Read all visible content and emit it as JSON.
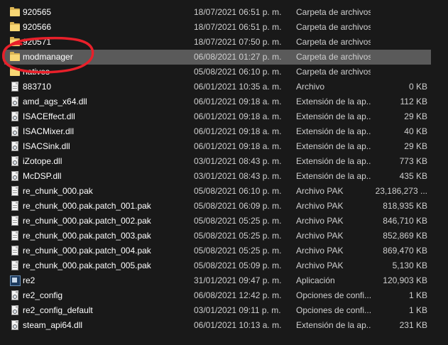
{
  "rows": [
    {
      "name": "920565",
      "date": "18/07/2021 06:51 p. m.",
      "type": "Carpeta de archivos",
      "size": "",
      "icon": "folder-icon"
    },
    {
      "name": "920566",
      "date": "18/07/2021 06:51 p. m.",
      "type": "Carpeta de archivos",
      "size": "",
      "icon": "folder-icon"
    },
    {
      "name": "920571",
      "date": "18/07/2021 07:50 p. m.",
      "type": "Carpeta de archivos",
      "size": "",
      "icon": "folder-icon"
    },
    {
      "name": "modmanager",
      "date": "06/08/2021 01:27 p. m.",
      "type": "Carpeta de archivos",
      "size": "",
      "icon": "folder-icon",
      "selected": true
    },
    {
      "name": "natives",
      "date": "05/08/2021 06:10 p. m.",
      "type": "Carpeta de archivos",
      "size": "",
      "icon": "folder-icon"
    },
    {
      "name": "883710",
      "date": "06/01/2021 10:35 a. m.",
      "type": "Archivo",
      "size": "0 KB",
      "icon": "file-icon"
    },
    {
      "name": "amd_ags_x64.dll",
      "date": "06/01/2021 09:18 a. m.",
      "type": "Extensión de la ap...",
      "size": "112 KB",
      "icon": "dll-file-icon"
    },
    {
      "name": "ISACEffect.dll",
      "date": "06/01/2021 09:18 a. m.",
      "type": "Extensión de la ap...",
      "size": "29 KB",
      "icon": "dll-file-icon"
    },
    {
      "name": "ISACMixer.dll",
      "date": "06/01/2021 09:18 a. m.",
      "type": "Extensión de la ap...",
      "size": "40 KB",
      "icon": "dll-file-icon"
    },
    {
      "name": "ISACSink.dll",
      "date": "06/01/2021 09:18 a. m.",
      "type": "Extensión de la ap...",
      "size": "29 KB",
      "icon": "dll-file-icon"
    },
    {
      "name": "iZotope.dll",
      "date": "03/01/2021 08:43 p. m.",
      "type": "Extensión de la ap...",
      "size": "773 KB",
      "icon": "dll-file-icon"
    },
    {
      "name": "McDSP.dll",
      "date": "03/01/2021 08:43 p. m.",
      "type": "Extensión de la ap...",
      "size": "435 KB",
      "icon": "dll-file-icon"
    },
    {
      "name": "re_chunk_000.pak",
      "date": "05/08/2021 06:10 p. m.",
      "type": "Archivo PAK",
      "size": "23,186,273 ...",
      "icon": "file-icon"
    },
    {
      "name": "re_chunk_000.pak.patch_001.pak",
      "date": "05/08/2021 06:09 p. m.",
      "type": "Archivo PAK",
      "size": "818,935 KB",
      "icon": "file-icon"
    },
    {
      "name": "re_chunk_000.pak.patch_002.pak",
      "date": "05/08/2021 05:25 p. m.",
      "type": "Archivo PAK",
      "size": "846,710 KB",
      "icon": "file-icon"
    },
    {
      "name": "re_chunk_000.pak.patch_003.pak",
      "date": "05/08/2021 05:25 p. m.",
      "type": "Archivo PAK",
      "size": "852,869 KB",
      "icon": "file-icon"
    },
    {
      "name": "re_chunk_000.pak.patch_004.pak",
      "date": "05/08/2021 05:25 p. m.",
      "type": "Archivo PAK",
      "size": "869,470 KB",
      "icon": "file-icon"
    },
    {
      "name": "re_chunk_000.pak.patch_005.pak",
      "date": "05/08/2021 05:09 p. m.",
      "type": "Archivo PAK",
      "size": "5,130 KB",
      "icon": "file-icon"
    },
    {
      "name": "re2",
      "date": "31/01/2021 09:47 p. m.",
      "type": "Aplicación",
      "size": "120,903 KB",
      "icon": "application-icon"
    },
    {
      "name": "re2_config",
      "date": "06/08/2021 12:42 p. m.",
      "type": "Opciones de confi...",
      "size": "1 KB",
      "icon": "config-file-icon"
    },
    {
      "name": "re2_config_default",
      "date": "03/01/2021 09:11 p. m.",
      "type": "Opciones de confi...",
      "size": "1 KB",
      "icon": "config-file-icon"
    },
    {
      "name": "steam_api64.dll",
      "date": "06/01/2021 10:13 a. m.",
      "type": "Extensión de la ap...",
      "size": "231 KB",
      "icon": "dll-file-icon"
    }
  ],
  "colors": {
    "background": "#191919",
    "selection": "#5a5a5a",
    "annotation_circle": "#e8202a",
    "folder": "#f8d775"
  }
}
